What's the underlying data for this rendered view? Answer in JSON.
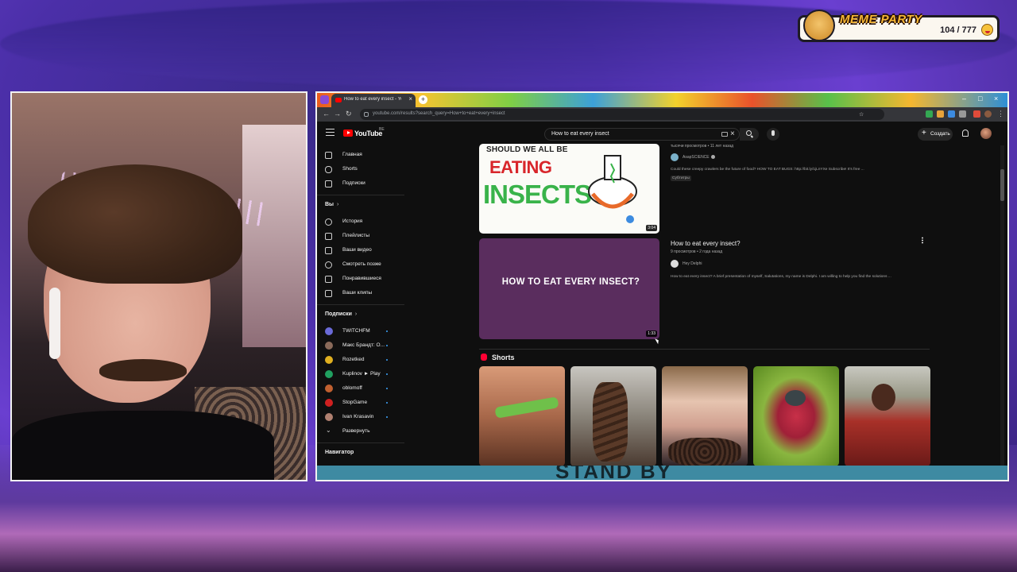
{
  "overlay": {
    "meme_party": {
      "title": "MEME PARTY",
      "count": "104 / 777"
    }
  },
  "browser": {
    "tab_title": "How to eat every insect - YouTube",
    "url": "youtube.com/results?search_query=How+to+eat+every+insect",
    "nav": {
      "back": "←",
      "forward": "→",
      "reload": "↻"
    }
  },
  "youtube": {
    "logo": "YouTube",
    "country": "BE",
    "search_query": "How to eat every insect",
    "create_label": "Создать",
    "sidebar": {
      "main": [
        {
          "label": "Главная",
          "icon": "home-icon"
        },
        {
          "label": "Shorts",
          "icon": "shorts-icon"
        },
        {
          "label": "Подписки",
          "icon": "subscriptions-icon"
        }
      ],
      "you_header": "Вы",
      "you": [
        {
          "label": "История",
          "icon": "history-icon"
        },
        {
          "label": "Плейлисты",
          "icon": "playlists-icon"
        },
        {
          "label": "Ваши видео",
          "icon": "your-videos-icon"
        },
        {
          "label": "Смотреть позже",
          "icon": "watch-later-icon"
        },
        {
          "label": "Понравившиеся",
          "icon": "like-icon"
        },
        {
          "label": "Ваши клипы",
          "icon": "clips-icon"
        }
      ],
      "subs_header": "Подписки",
      "subs": [
        {
          "label": "TWITCHFM",
          "color": "#6a6ad8"
        },
        {
          "label": "Макс Брандт: О...",
          "color": "#8a6a5a"
        },
        {
          "label": "Rozetked",
          "color": "#e0b020"
        },
        {
          "label": "Kuplinov ► Play",
          "color": "#20a060"
        },
        {
          "label": "oblomoff",
          "color": "#c06030"
        },
        {
          "label": "StopGame",
          "color": "#d02020"
        },
        {
          "label": "Ivan Krasavin",
          "color": "#b08070"
        }
      ],
      "expand_label": "Развернуть",
      "navigator_header": "Навигатор"
    },
    "results": [
      {
        "thumb_lines": [
          "SHOULD WE ALL BE",
          "EATING",
          "INSECTS?"
        ],
        "duration": "3:04",
        "meta": "тысячи просмотров • 11 лет назад",
        "channel": "AsapSCIENCE",
        "description": "Could these creepy crawlers be the future of food? HOW TO EAT BUGS: http://bit.ly/1jLnYXe Subscribe! It's free ...",
        "chip": "Субтитры"
      },
      {
        "thumb_text": "HOW TO EAT EVERY INSECT?",
        "duration": "1:33",
        "title": "How to eat every insect?",
        "meta": "9 просмотров • 2 года назад",
        "channel": "Hey Delphi",
        "description": "How to eat every insect? A brief presentation of myself, Salutations, my name is Delphi. I am willing to help you find the solutions ..."
      }
    ],
    "shorts_label": "Shorts",
    "shorts_colors": [
      "#b97a58",
      "#7a7268",
      "#4a3a32",
      "#8ab640",
      "#9a3a38"
    ]
  },
  "stream": {
    "standby_text": "STAND BY"
  }
}
